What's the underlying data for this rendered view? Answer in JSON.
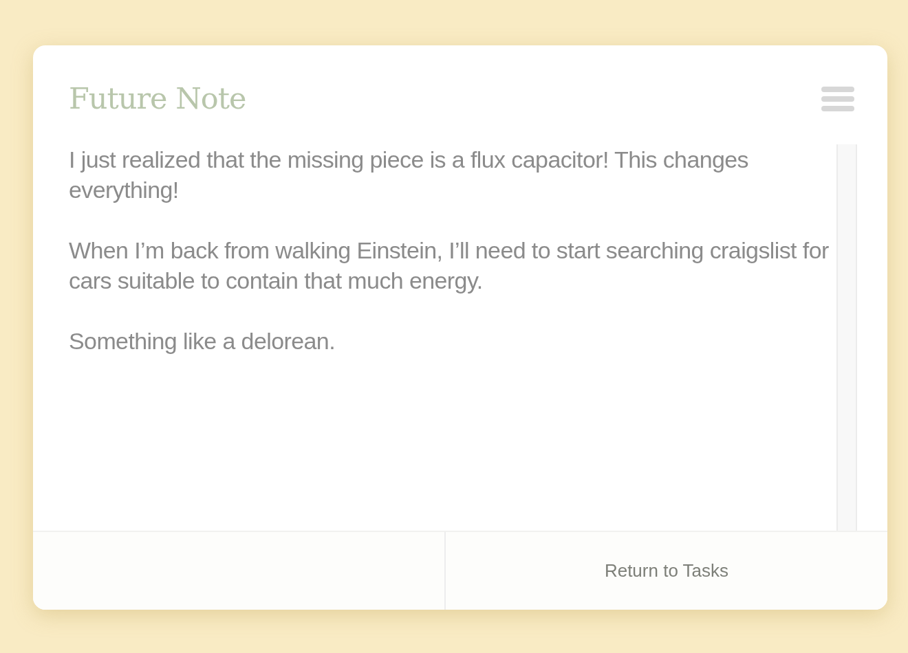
{
  "note": {
    "title": "Future Note",
    "paragraphs": [
      "I just realized that the missing piece is a flux capacitor! This changes everything!",
      "When I’m back from walking Einstein, I’ll need to start searching craigslist for cars suitable to contain that much energy.",
      "Something like a delorean."
    ]
  },
  "footer": {
    "return_button": "Return to Tasks"
  }
}
